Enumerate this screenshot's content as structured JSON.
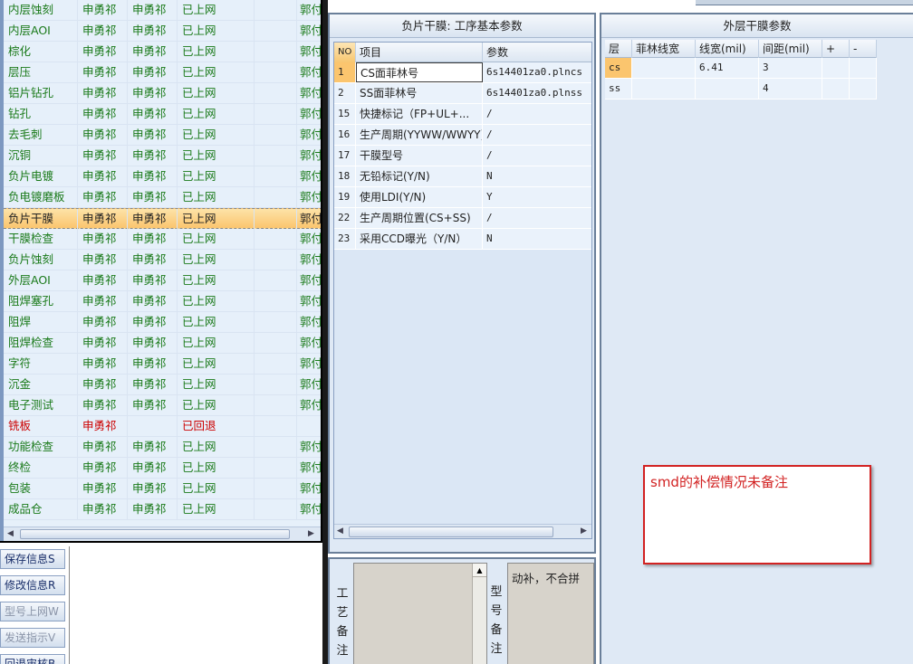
{
  "process_table": {
    "rows": [
      {
        "name": "内层蚀刻",
        "p1": "申勇祁",
        "p2": "申勇祁",
        "status": "已上网",
        "extra": "",
        "owner": "郭付"
      },
      {
        "name": "内层AOI",
        "p1": "申勇祁",
        "p2": "申勇祁",
        "status": "已上网",
        "extra": "",
        "owner": "郭付"
      },
      {
        "name": "棕化",
        "p1": "申勇祁",
        "p2": "申勇祁",
        "status": "已上网",
        "extra": "",
        "owner": "郭付"
      },
      {
        "name": "层压",
        "p1": "申勇祁",
        "p2": "申勇祁",
        "status": "已上网",
        "extra": "",
        "owner": "郭付"
      },
      {
        "name": "铝片钻孔",
        "p1": "申勇祁",
        "p2": "申勇祁",
        "status": "已上网",
        "extra": "",
        "owner": "郭付"
      },
      {
        "name": "钻孔",
        "p1": "申勇祁",
        "p2": "申勇祁",
        "status": "已上网",
        "extra": "",
        "owner": "郭付"
      },
      {
        "name": "去毛刺",
        "p1": "申勇祁",
        "p2": "申勇祁",
        "status": "已上网",
        "extra": "",
        "owner": "郭付"
      },
      {
        "name": "沉铜",
        "p1": "申勇祁",
        "p2": "申勇祁",
        "status": "已上网",
        "extra": "",
        "owner": "郭付"
      },
      {
        "name": "负片电镀",
        "p1": "申勇祁",
        "p2": "申勇祁",
        "status": "已上网",
        "extra": "",
        "owner": "郭付"
      },
      {
        "name": "负电镀磨板",
        "p1": "申勇祁",
        "p2": "申勇祁",
        "status": "已上网",
        "extra": "",
        "owner": "郭付"
      },
      {
        "name": "负片干膜",
        "p1": "申勇祁",
        "p2": "申勇祁",
        "status": "已上网",
        "extra": "",
        "owner": "郭付"
      },
      {
        "name": "干膜检查",
        "p1": "申勇祁",
        "p2": "申勇祁",
        "status": "已上网",
        "extra": "",
        "owner": "郭付"
      },
      {
        "name": "负片蚀刻",
        "p1": "申勇祁",
        "p2": "申勇祁",
        "status": "已上网",
        "extra": "",
        "owner": "郭付"
      },
      {
        "name": "外层AOI",
        "p1": "申勇祁",
        "p2": "申勇祁",
        "status": "已上网",
        "extra": "",
        "owner": "郭付"
      },
      {
        "name": "阻焊塞孔",
        "p1": "申勇祁",
        "p2": "申勇祁",
        "status": "已上网",
        "extra": "",
        "owner": "郭付"
      },
      {
        "name": "阻焊",
        "p1": "申勇祁",
        "p2": "申勇祁",
        "status": "已上网",
        "extra": "",
        "owner": "郭付"
      },
      {
        "name": "阻焊检查",
        "p1": "申勇祁",
        "p2": "申勇祁",
        "status": "已上网",
        "extra": "",
        "owner": "郭付"
      },
      {
        "name": "字符",
        "p1": "申勇祁",
        "p2": "申勇祁",
        "status": "已上网",
        "extra": "",
        "owner": "郭付"
      },
      {
        "name": "沉金",
        "p1": "申勇祁",
        "p2": "申勇祁",
        "status": "已上网",
        "extra": "",
        "owner": "郭付"
      },
      {
        "name": "电子测试",
        "p1": "申勇祁",
        "p2": "申勇祁",
        "status": "已上网",
        "extra": "",
        "owner": "郭付"
      },
      {
        "name": "铣板",
        "p1": "申勇祁",
        "p2": "",
        "status": "已回退",
        "extra": "",
        "owner": ""
      },
      {
        "name": "功能检查",
        "p1": "申勇祁",
        "p2": "申勇祁",
        "status": "已上网",
        "extra": "",
        "owner": "郭付"
      },
      {
        "name": "终检",
        "p1": "申勇祁",
        "p2": "申勇祁",
        "status": "已上网",
        "extra": "",
        "owner": "郭付"
      },
      {
        "name": "包装",
        "p1": "申勇祁",
        "p2": "申勇祁",
        "status": "已上网",
        "extra": "",
        "owner": "郭付"
      },
      {
        "name": "成品仓",
        "p1": "申勇祁",
        "p2": "申勇祁",
        "status": "已上网",
        "extra": "",
        "owner": "郭付"
      }
    ],
    "selected_index": 10,
    "reverted_index": 20
  },
  "side_buttons": [
    {
      "label": "保存信息S",
      "enabled": true
    },
    {
      "label": "修改信息R",
      "enabled": true
    },
    {
      "label": "型号上网W",
      "enabled": false
    },
    {
      "label": "发送指示V",
      "enabled": false
    },
    {
      "label": "回退审核B",
      "enabled": true
    }
  ],
  "mid_panel": {
    "title": "负片干膜: 工序基本参数",
    "headers": {
      "no": "NO",
      "item": "项目",
      "value": "参数"
    },
    "rows": [
      {
        "no": "1",
        "item": "CS面菲林号",
        "value": "6s14401za0.plncs"
      },
      {
        "no": "2",
        "item": "SS面菲林号",
        "value": "6s14401za0.plnss"
      },
      {
        "no": "15",
        "item": "快捷标记（FP+UL+...",
        "value": "/"
      },
      {
        "no": "16",
        "item": "生产周期(YYWW/WWYY)",
        "value": "/"
      },
      {
        "no": "17",
        "item": "干膜型号",
        "value": "/"
      },
      {
        "no": "18",
        "item": "无铅标记(Y/N)",
        "value": "N"
      },
      {
        "no": "19",
        "item": "使用LDI(Y/N)",
        "value": "Y"
      },
      {
        "no": "22",
        "item": "生产周期位置(CS+SS)",
        "value": "/"
      },
      {
        "no": "23",
        "item": "采用CCD曝光（Y/N）",
        "value": "N"
      }
    ]
  },
  "notes": {
    "process_label": "工艺备注",
    "model_label": "型号备注",
    "model_note": "动补，不合拼"
  },
  "right_panel": {
    "title": "外层干膜参数",
    "headers": [
      "层",
      "菲林线宽",
      "线宽(mil)",
      "间距(mil)",
      "+",
      "-"
    ],
    "rows": [
      [
        "cs",
        "",
        "6.41",
        "3",
        "",
        ""
      ],
      [
        "ss",
        "",
        "",
        "4",
        "",
        ""
      ]
    ]
  },
  "callout": {
    "text": "smd的补偿情况未备注",
    "color": "#d22222"
  }
}
